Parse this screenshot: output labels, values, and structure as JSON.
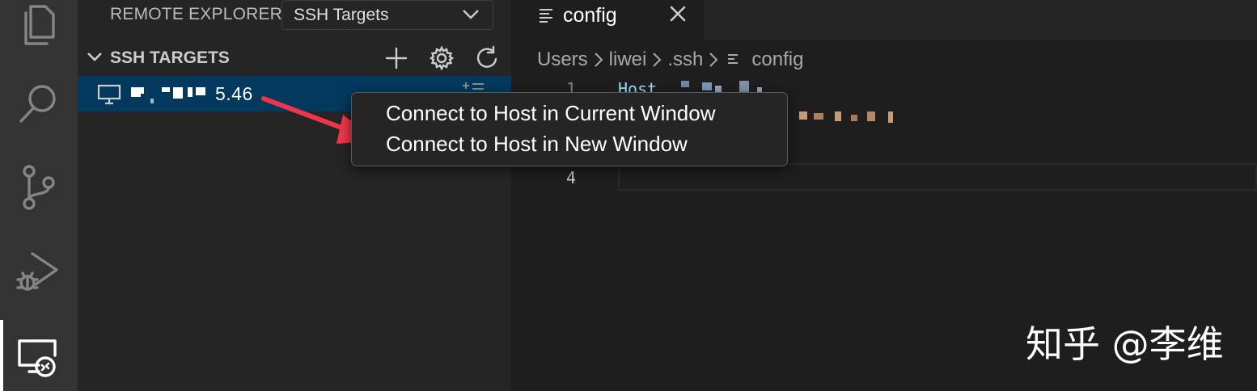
{
  "activity_bar": {
    "items": [
      {
        "name": "explorer",
        "icon": "files-icon"
      },
      {
        "name": "search",
        "icon": "search-icon"
      },
      {
        "name": "source-control",
        "icon": "source-control-icon"
      },
      {
        "name": "run-debug",
        "icon": "run-debug-icon"
      },
      {
        "name": "remote-explorer",
        "icon": "remote-explorer-icon",
        "active": true
      }
    ]
  },
  "sidebar": {
    "title": "REMOTE EXPLORER",
    "target_select": {
      "value": "SSH Targets",
      "icon": "chevron-down-icon"
    },
    "section": {
      "title": "SSH TARGETS",
      "actions": [
        {
          "name": "add",
          "icon": "plus-icon"
        },
        {
          "name": "configure",
          "icon": "gear-icon"
        },
        {
          "name": "refresh",
          "icon": "refresh-icon"
        }
      ]
    },
    "host": {
      "visible_suffix": "5.46",
      "icon": "monitor-icon",
      "action_icon": "open-in-window-icon"
    }
  },
  "editor": {
    "tab": {
      "label": "config",
      "icon": "file-lines-icon",
      "close_icon": "close-icon"
    },
    "breadcrumb": [
      "Users",
      "liwei",
      ".ssh",
      "config"
    ],
    "lines": [
      {
        "number": "1",
        "keyword": "Host"
      },
      {
        "number": "4"
      }
    ]
  },
  "context_menu": {
    "items": [
      "Connect to Host in Current Window",
      "Connect to Host in New Window"
    ]
  },
  "annotation": {
    "arrow_color": "#f0354a"
  },
  "watermark": "知乎 @李维",
  "colors": {
    "activity_bar": "#333333",
    "sidebar": "#252526",
    "editor": "#1e1e1e",
    "selection": "#04395e",
    "keyword": "#9cdcfe"
  }
}
